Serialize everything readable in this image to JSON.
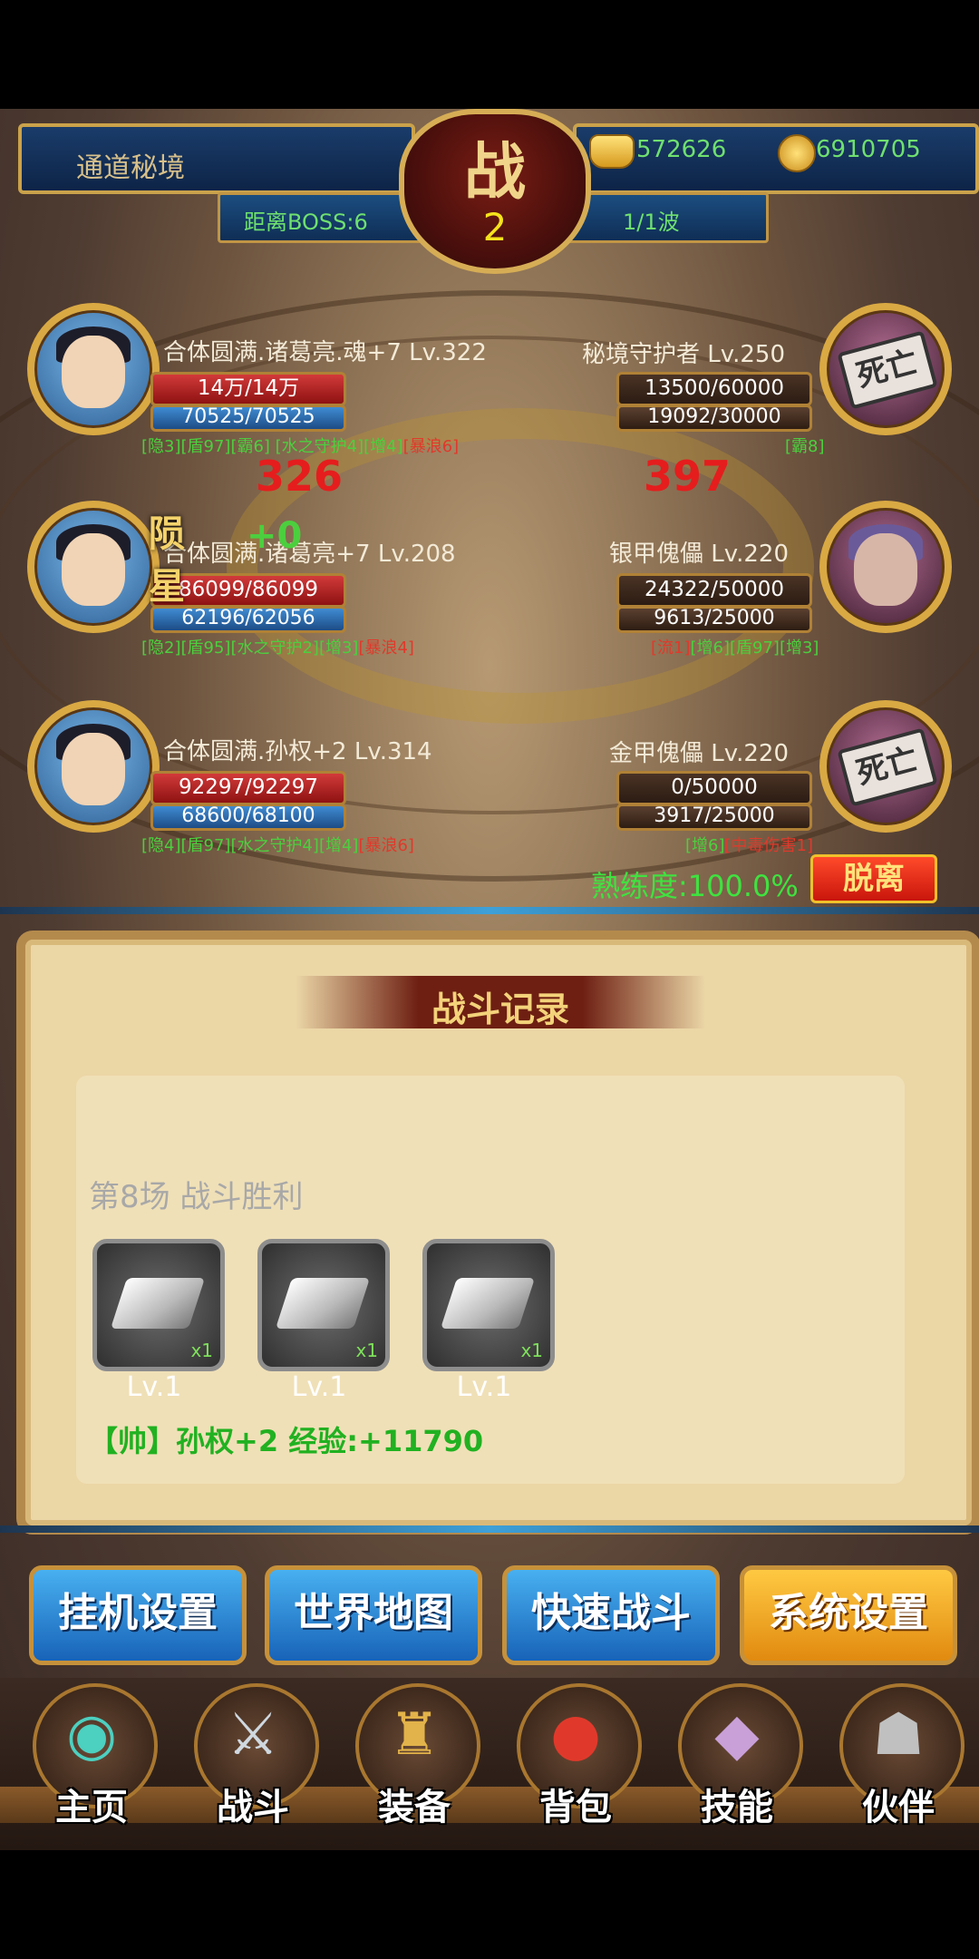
{
  "topbar": {
    "location": "通道秘境",
    "boss_distance": "距离BOSS:6",
    "wave": "1/1波",
    "battle_char": "战",
    "battle_num": "2",
    "gold": "572626",
    "coins": "6910705"
  },
  "allies": [
    {
      "name": "合体圆满.诸葛亮.魂+7 Lv.322",
      "hp": "14万/14万",
      "mp": "70525/70525",
      "buffs": "[隐3][盾97][霸6] [水之守护4][增4]",
      "buffs_red": "[暴浪6]",
      "damage": "326"
    },
    {
      "name": "合体圆满.诸葛亮+7 Lv.208",
      "hp": "86099/86099",
      "mp": "62196/62056",
      "buffs": "[隐2][盾95][水之守护2][增3]",
      "buffs_red": "[暴浪4]",
      "fx": "陨星",
      "fx2": "+0"
    },
    {
      "name": "合体圆满.孙权+2 Lv.314",
      "hp": "92297/92297",
      "mp": "68600/68100",
      "buffs": "[隐4][盾97][水之守护4][增4]",
      "buffs_red": "[暴浪6]"
    }
  ],
  "enemies": [
    {
      "name": "秘境守护者 Lv.250",
      "hp": "13500/60000",
      "mp": "19092/30000",
      "buffs": "[霸8]",
      "buffs_red": "",
      "damage": "397",
      "dead_stamp": "死亡"
    },
    {
      "name": "银甲傀儡 Lv.220",
      "hp": "24322/50000",
      "mp": "9613/25000",
      "buffs": "[增6][盾97][增3]",
      "buffs_red": "[流1]"
    },
    {
      "name": "金甲傀儡 Lv.220",
      "hp": "0/50000",
      "mp": "3917/25000",
      "buffs": "[增6]",
      "buffs_red": "[中毒伤害1]",
      "dead_stamp": "死亡"
    }
  ],
  "mastery": "熟练度:100.0%",
  "leave_button": "脱离",
  "battle_log": {
    "title": "战斗记录",
    "result": "第8场 战斗胜利",
    "items": [
      {
        "qty": "x1",
        "level": "Lv.1"
      },
      {
        "qty": "x1",
        "level": "Lv.1"
      },
      {
        "qty": "x1",
        "level": "Lv.1"
      }
    ],
    "exp_line": "【帅】孙权+2 经验:+11790"
  },
  "actions": [
    "挂机设置",
    "世界地图",
    "快速战斗",
    "系统设置"
  ],
  "nav": [
    {
      "label": "主页",
      "icon": "home-icon"
    },
    {
      "label": "战斗",
      "icon": "battle-icon"
    },
    {
      "label": "装备",
      "icon": "equipment-icon"
    },
    {
      "label": "背包",
      "icon": "bag-icon"
    },
    {
      "label": "技能",
      "icon": "skill-icon"
    },
    {
      "label": "伙伴",
      "icon": "partner-icon"
    }
  ]
}
